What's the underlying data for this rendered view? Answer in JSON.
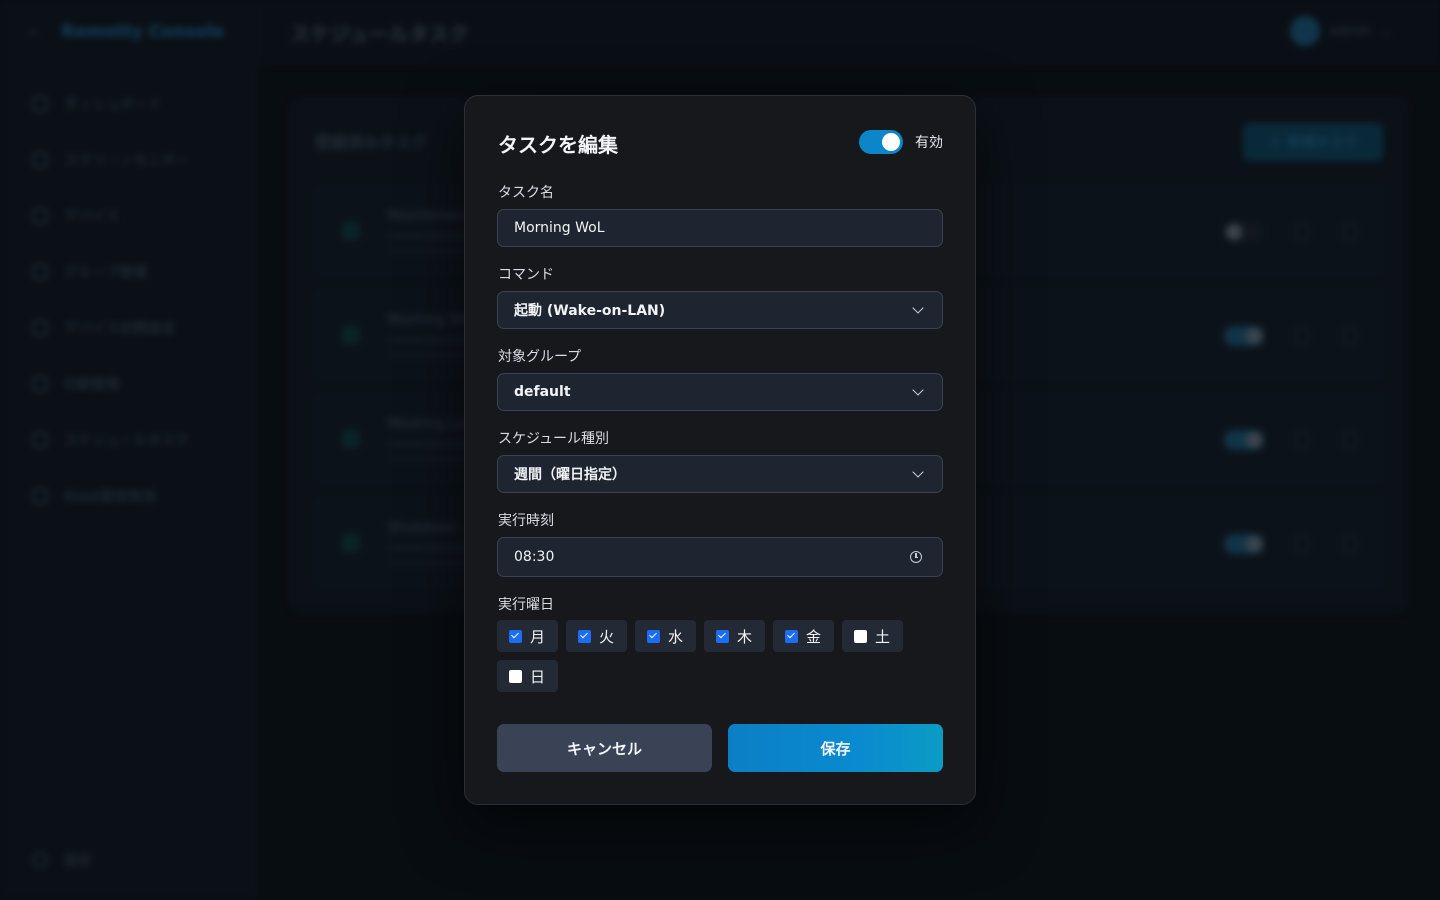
{
  "background": {
    "app_name": "Remotty Console",
    "page_title": "スケジュールタスク",
    "user_name": "admin",
    "sidebar": {
      "items": [
        {
          "label": "ダッシュボード"
        },
        {
          "label": "スクリーンモニター"
        },
        {
          "label": "デバイス"
        },
        {
          "label": "グループ管理"
        },
        {
          "label": "デバイス初期設定"
        },
        {
          "label": "印刷管理"
        },
        {
          "label": "スケジュールタスク"
        },
        {
          "label": "Kiosk配信有効"
        }
      ],
      "settings_label": "設定"
    },
    "panel_title": "登録済みタスク",
    "new_task_label": "＋ 新規タスク",
    "tasks": [
      {
        "name": "Maintenance"
      },
      {
        "name": "Morning Wo"
      },
      {
        "name": "Meeting Lock"
      },
      {
        "name": "Shutdown"
      }
    ]
  },
  "modal": {
    "title": "タスクを編集",
    "enabled_label": "有効",
    "enabled": true,
    "task_name_label": "タスク名",
    "task_name_value": "Morning WoL",
    "command_label": "コマンド",
    "command_value": "起動 (Wake-on-LAN)",
    "group_label": "対象グループ",
    "group_value": "default",
    "schedule_type_label": "スケジュール種別",
    "schedule_type_value": "週間（曜日指定）",
    "time_label": "実行時刻",
    "time_value": "08:30",
    "days_label": "実行曜日",
    "days": [
      {
        "label": "月",
        "checked": true
      },
      {
        "label": "火",
        "checked": true
      },
      {
        "label": "水",
        "checked": true
      },
      {
        "label": "木",
        "checked": true
      },
      {
        "label": "金",
        "checked": true
      },
      {
        "label": "土",
        "checked": false
      },
      {
        "label": "日",
        "checked": false
      }
    ],
    "cancel_label": "キャンセル",
    "save_label": "保存"
  },
  "colors": {
    "accent": "#0a86c9",
    "checkbox": "#1b6ef3",
    "modal_bg": "#16181c",
    "field_bg": "#1e2430"
  }
}
